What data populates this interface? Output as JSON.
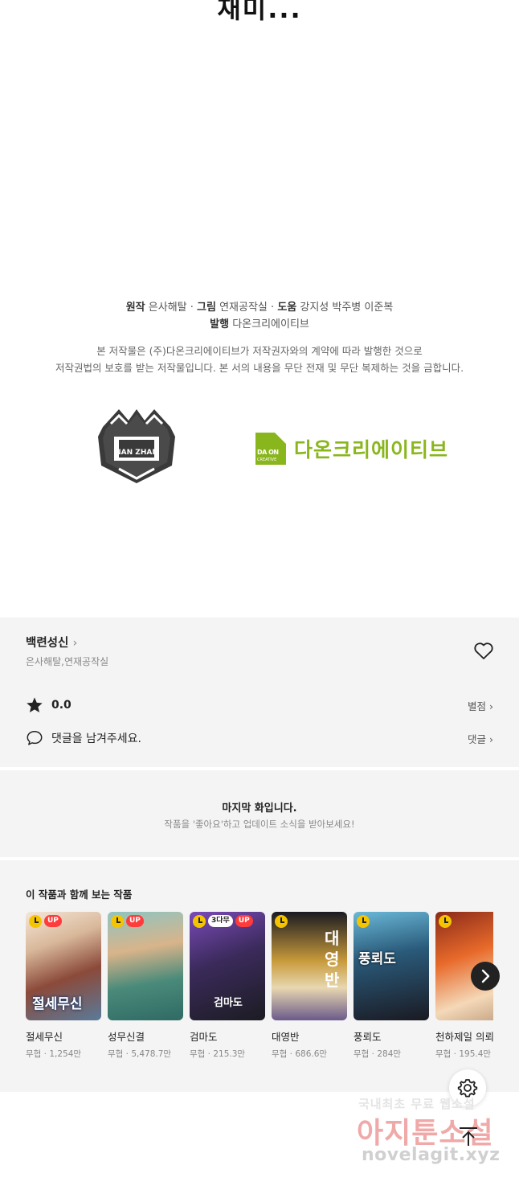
{
  "top_fragment": "재미...",
  "credits": {
    "original_label": "원작",
    "original_value": "은사해탈",
    "art_label": "그림",
    "art_value": "연재공작실",
    "help_label": "도움",
    "help_value": "강지성 박주병 이준복",
    "publisher_label": "발행",
    "publisher_value": "다온크리에이티브",
    "separator": " · "
  },
  "notice": {
    "line1": "본 저작물은 (주)다온크리에이티브가 저작권자와의 계약에 따라 발행한 것으로",
    "line2": "저작권법의 보호를 받는 저작물입니다. 본 서의 내용을 무단 전재 및 무단 복제하는 것을 금합니다."
  },
  "logos": {
    "left_text": "NAN ZHAN",
    "daon_box_text": "DA ON",
    "daon_box_sub": "CREATIVE",
    "daon_name": "다온크리에이티브",
    "daon_color": "#8ab61d"
  },
  "series": {
    "title": "백련성신",
    "authors": "은사해탈,연재공작실",
    "rating": "0.0",
    "rating_link": "별점",
    "comment_prompt": "댓글을 남겨주세요.",
    "comment_link": "댓글"
  },
  "last_episode": {
    "title": "마지막 화입니다.",
    "subtitle": "작품을 '좋아요'하고 업데이트 소식을 받아보세요!"
  },
  "recommendations": {
    "heading": "이 작품과 함께 보는 작품",
    "items": [
      {
        "title": "절세무신",
        "meta": "무협 · 1,254만",
        "badges": [
          "UP"
        ],
        "cover_text": "절세무신"
      },
      {
        "title": "성무신결",
        "meta": "무협 · 5,478.7만",
        "badges": [
          "UP"
        ],
        "cover_text": ""
      },
      {
        "title": "검마도",
        "meta": "무협 · 215.3만",
        "badges": [
          "3다무",
          "UP"
        ],
        "cover_text": "검마도"
      },
      {
        "title": "대영반",
        "meta": "무협 · 686.6만",
        "badges": [],
        "cover_text": "대영반"
      },
      {
        "title": "풍뢰도",
        "meta": "무협 · 284만",
        "badges": [],
        "cover_text": "풍뢰도"
      },
      {
        "title": "천하제일 의뢰",
        "meta": "무협 · 195.4만",
        "badges": [],
        "cover_text": ""
      }
    ]
  },
  "watermark": {
    "line1": "국내최초 무료 웹소설",
    "line2": "아지툰소설",
    "line3": "novelagit.xyz"
  },
  "colors": {
    "panel_bg": "#f4f4f4",
    "badge_up": "#ff3b3b",
    "badge_clock": "#f5c400",
    "text_dark": "#222222",
    "text_muted": "#888888"
  }
}
